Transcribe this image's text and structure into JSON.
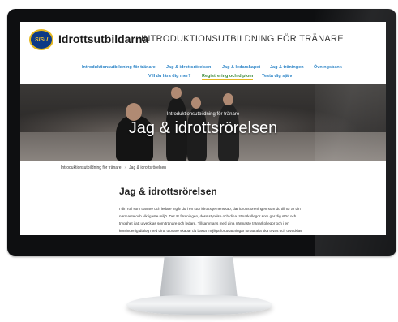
{
  "site": {
    "brand_name": "Idrottsutbildarna",
    "logo_text": "SISU",
    "section_title": "INTRODUKTIONSUTBILDNING FÖR TRÄNARE"
  },
  "nav": {
    "row1": [
      {
        "label": "Introduktionsutbildning för tränare",
        "active": false
      },
      {
        "label": "Jag & idrottsrörelsen",
        "active": true
      },
      {
        "label": "Jag & ledarskapet",
        "active": false
      },
      {
        "label": "Jag & träningen",
        "active": false
      },
      {
        "label": "Övningsbank",
        "active": false
      }
    ],
    "row2": [
      {
        "label": "Vill du lära dig mer?"
      },
      {
        "label": "Registrering och diplom",
        "active": true
      },
      {
        "label": "Testa dig själv"
      }
    ]
  },
  "hero": {
    "kicker": "Introduktionsutbildning för tränare",
    "title": "Jag & idrottsrörelsen"
  },
  "breadcrumb": [
    "Introduktionsutbildning för tränare",
    "Jag & idrottsrörelsen"
  ],
  "content": {
    "title": "Jag & idrottsrörelsen",
    "paragraph_lines": [
      "I din roll som tränare och ledare ingår du i en stor idrottsgemenskap, där idrottsföreningen som du tillhör är din",
      "närmaste och viktigaste miljö. Det är föreningen, dess styrelse och dina tränarkollegor som ger dig stöd och",
      "trygghet i att utvecklas som tränare och ledare. Tillsammans med dina närmaste tränarkollegor och i en",
      "kontinuerlig dialog med dina utövare skapar du bästa möjliga förutsättningar för att alla ska trivas och utvecklas"
    ]
  },
  "colors": {
    "link_blue": "#2a83c6",
    "accent_yellow": "#e5b81f",
    "logo_blue": "#0d3a86",
    "active_green": "#3a8a3a"
  }
}
